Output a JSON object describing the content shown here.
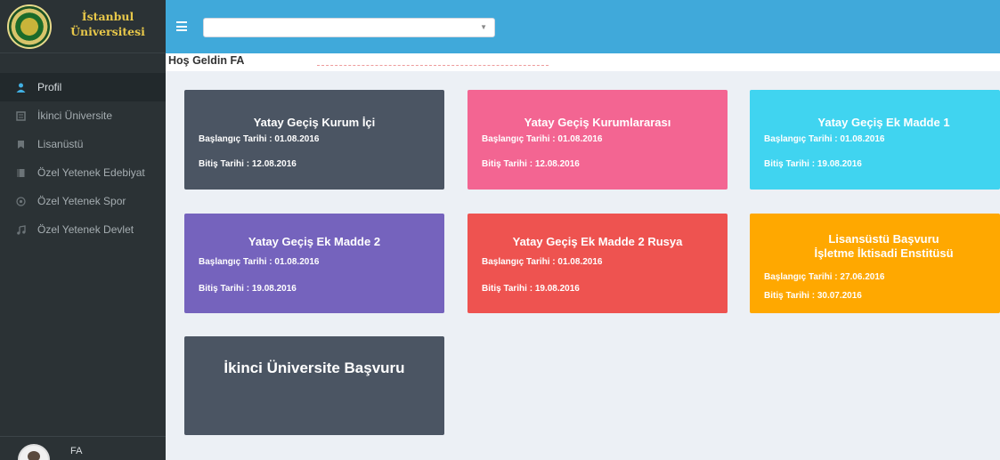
{
  "brand": {
    "line1": "İstanbul",
    "line2": "Üniversitesi"
  },
  "topbar": {
    "select_value": ""
  },
  "welcome": {
    "text": "Hoş Geldin FA"
  },
  "sidebar": {
    "items": [
      {
        "label": "Profil",
        "icon": "user-icon",
        "active": true
      },
      {
        "label": "İkinci Üniversite",
        "icon": "document-icon"
      },
      {
        "label": "Lisanüstü",
        "icon": "bookmark-icon"
      },
      {
        "label": "Özel Yetenek Edebiyat",
        "icon": "book-icon"
      },
      {
        "label": "Özel Yetenek Spor",
        "icon": "football-icon"
      },
      {
        "label": "Özel Yetenek Devlet",
        "icon": "music-icon"
      }
    ]
  },
  "user": {
    "name": "FA"
  },
  "cards": [
    {
      "title": "Yatay Geçiş Kurum İçi",
      "start": "Başlangıç Tarihi : 01.08.2016",
      "end": "Bitiş Tarihi : 12.08.2016",
      "color": "#4b5563"
    },
    {
      "title": "Yatay Geçiş Kurumlararası",
      "start": "Başlangıç Tarihi : 01.08.2016",
      "end": "Bitiş Tarihi : 12.08.2016",
      "color": "#f36592"
    },
    {
      "title": "Yatay Geçiş Ek Madde 1",
      "start": "Başlangıç Tarihi : 01.08.2016",
      "end": "Bitiş Tarihi : 19.08.2016",
      "color": "#40d4f0"
    },
    {
      "title": "Yatay Geçiş Ek Madde 2",
      "start": "Başlangıç Tarihi : 01.08.2016",
      "end": "Bitiş Tarihi : 19.08.2016",
      "color": "#7563bd"
    },
    {
      "title": "Yatay Geçiş Ek Madde 2 Rusya",
      "start": "Başlangıç Tarihi : 01.08.2016",
      "end": "Bitiş Tarihi : 19.08.2016",
      "color": "#ee5350"
    },
    {
      "title": "Lisansüstü Başvuru",
      "title2": "İşletme İktisadi Enstitüsü",
      "start": "Başlangıç Tarihi : 27.06.2016",
      "end": "Bitiş Tarihi : 30.07.2016",
      "color": "#ffa800"
    },
    {
      "title": "İkinci Üniversite Başvuru",
      "color": "#4b5563"
    }
  ]
}
